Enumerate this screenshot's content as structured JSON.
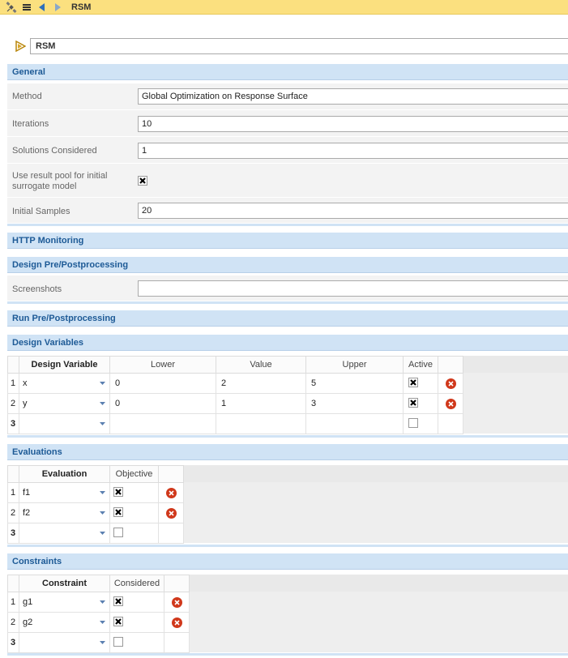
{
  "toolbar": {
    "title": "RSM",
    "icons": [
      "satellite-icon",
      "list-icon",
      "back-arrow-icon",
      "forward-arrow-icon"
    ]
  },
  "name_field": {
    "value": "RSM"
  },
  "sections": {
    "general": "General",
    "http": "HTTP Monitoring",
    "design_pp": "Design Pre/Postprocessing",
    "run_pp": "Run Pre/Postprocessing",
    "design_vars": "Design Variables",
    "evaluations": "Evaluations",
    "constraints": "Constraints"
  },
  "general": {
    "method_label": "Method",
    "method_value": "Global Optimization on Response Surface",
    "iterations_label": "Iterations",
    "iterations_value": "10",
    "solutions_label": "Solutions Considered",
    "solutions_value": "1",
    "pool_label_1": "Use result pool for initial",
    "pool_label_2": "surrogate model",
    "pool_checked": true,
    "samples_label": "Initial Samples",
    "samples_value": "20"
  },
  "design_pp": {
    "screenshots_label": "Screenshots",
    "screenshots_value": ""
  },
  "design_variables": {
    "headers": {
      "name": "Design Variable",
      "lower": "Lower",
      "value": "Value",
      "upper": "Upper",
      "active": "Active"
    },
    "rows": [
      {
        "num": "1",
        "name": "x",
        "lower": "0",
        "value": "2",
        "upper": "5",
        "active": true
      },
      {
        "num": "2",
        "name": "y",
        "lower": "0",
        "value": "1",
        "upper": "3",
        "active": true
      },
      {
        "num": "3",
        "name": "",
        "lower": "",
        "value": "",
        "upper": "",
        "active": false
      }
    ]
  },
  "evaluations": {
    "headers": {
      "name": "Evaluation",
      "objective": "Objective"
    },
    "rows": [
      {
        "num": "1",
        "name": "f1",
        "objective": true
      },
      {
        "num": "2",
        "name": "f2",
        "objective": true
      },
      {
        "num": "3",
        "name": "",
        "objective": false
      }
    ]
  },
  "constraints": {
    "headers": {
      "name": "Constraint",
      "considered": "Considered"
    },
    "rows": [
      {
        "num": "1",
        "name": "g1",
        "considered": true
      },
      {
        "num": "2",
        "name": "g2",
        "considered": true
      },
      {
        "num": "3",
        "name": "",
        "considered": false
      }
    ]
  },
  "colors": {
    "toolbar_bg": "#fbe07f",
    "section_bg": "#d0e3f5",
    "section_text": "#1d5a96",
    "delete_red": "#d0381b"
  }
}
